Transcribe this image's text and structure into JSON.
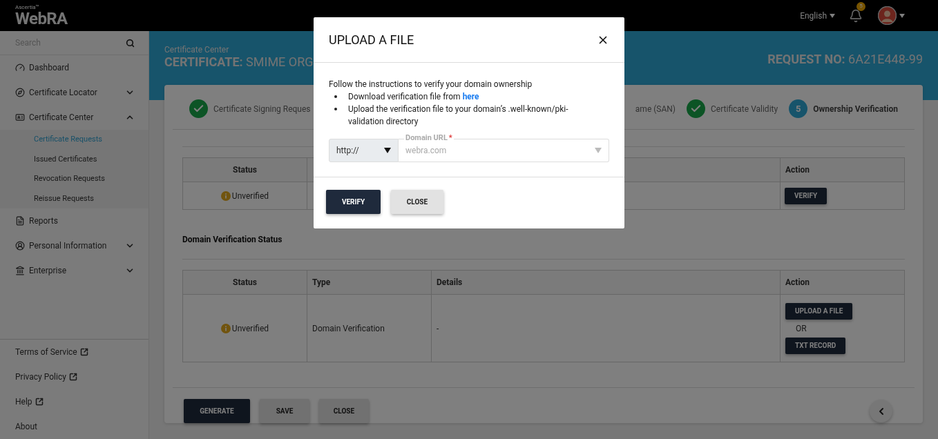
{
  "topbar": {
    "brand_small": "Ascertia™",
    "brand": "WebRA",
    "language": "English",
    "notification_count": "5"
  },
  "sidebar": {
    "search": {
      "placeholder": "Search"
    },
    "items": [
      {
        "label": "Dashboard",
        "kind": "link"
      },
      {
        "label": "Certificate Locator",
        "kind": "group",
        "expanded": false
      },
      {
        "label": "Certificate Center",
        "kind": "group",
        "expanded": true,
        "children": [
          {
            "label": "Certificate Requests",
            "selected": true
          },
          {
            "label": "Issued Certificates",
            "selected": false
          },
          {
            "label": "Revocation Requests",
            "selected": false
          },
          {
            "label": "Reissue Requests",
            "selected": false
          }
        ]
      },
      {
        "label": "Reports",
        "kind": "link"
      },
      {
        "label": "Personal Information",
        "kind": "group",
        "expanded": false
      },
      {
        "label": "Enterprise",
        "kind": "group",
        "expanded": false
      }
    ],
    "footer_links": [
      {
        "label": "Terms of Service",
        "external": true
      },
      {
        "label": "Privacy Policy",
        "external": true
      },
      {
        "label": "Help",
        "external": true
      },
      {
        "label": "About",
        "external": false
      }
    ]
  },
  "page_header": {
    "section": "Certificate Center",
    "title": "**CERTIFICATE:** SMIME ORG",
    "request": "**REQUEST NO:** 6A21E448-99"
  },
  "steps_left": [
    {
      "label": "Certificate Signing Reques",
      "kind": "done"
    }
  ],
  "steps_right": [
    {
      "label": "ame (SAN)",
      "kind": "cut"
    },
    {
      "label": "Certificate Validity",
      "kind": "done"
    },
    {
      "label": "Ownership Verification",
      "kind": "current",
      "number": "5"
    }
  ],
  "ownership_table": {
    "columns": [
      "Status",
      "Action"
    ],
    "rows": [
      {
        "status": "Unverified",
        "action": "VERIFY"
      }
    ]
  },
  "domain_section": {
    "title": "Domain Verification Status",
    "columns": [
      "Status",
      "Type",
      "Details",
      "Action"
    ],
    "rows": [
      {
        "status": "Unverified",
        "type": "Domain Verification",
        "details": "-",
        "actions": [
          "UPLOAD A FILE",
          "TXT RECORD"
        ],
        "separator": "OR"
      }
    ]
  },
  "footer_buttons": [
    {
      "label": "GENERATE",
      "kind": "primary"
    },
    {
      "label": "SAVE",
      "kind": "secondary"
    },
    {
      "label": "CLOSE",
      "kind": "secondary"
    }
  ],
  "modal": {
    "title": "UPLOAD A FILE",
    "intro": "Follow the instructions to verify your domain ownership",
    "bullets": [
      {
        "text": "Download verification file from",
        "link": "here"
      },
      {
        "text": "Upload the verification file to your domain’s .well-known/pki-validation directory"
      }
    ],
    "protocol": "http://",
    "domain_field": {
      "label": "Domain URL",
      "required_mark": "*",
      "required": true,
      "placeholder": "webra.com"
    },
    "buttons": [
      {
        "label": "VERIFY",
        "kind": "primary"
      },
      {
        "label": "CLOSE",
        "kind": "secondary"
      }
    ]
  }
}
